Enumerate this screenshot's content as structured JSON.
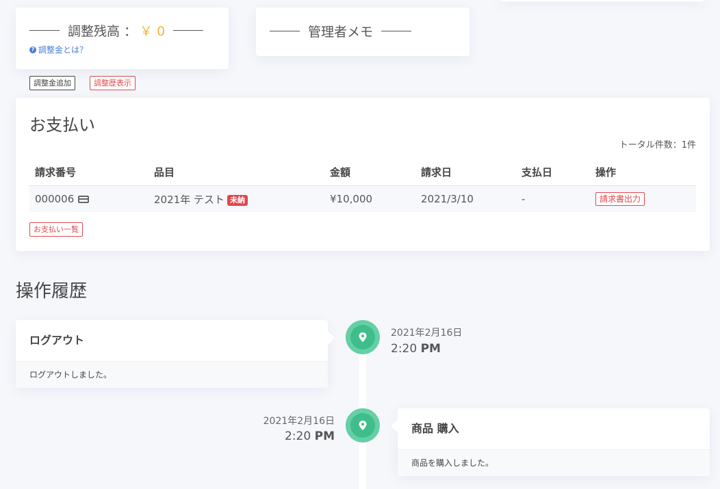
{
  "adjust": {
    "title": "調整残高 ：",
    "amount": "￥ 0",
    "help_link": "調整金とは？",
    "add_button": "調整金追加",
    "history_button": "調整歴表示"
  },
  "memo": {
    "title": "管理者メモ"
  },
  "payments": {
    "title": "お支払い",
    "total": "トータル件数：1件",
    "columns": [
      "請求番号",
      "品目",
      "金額",
      "請求日",
      "支払日",
      "操作"
    ],
    "rows": [
      {
        "invoice_no": "000006",
        "item": "2021年 テスト",
        "status_badge": "未納",
        "amount": "¥10,000",
        "invoice_date": "2021/3/10",
        "paid_date": "-",
        "action": "請求書出力"
      }
    ],
    "list_button": "お支払い一覧"
  },
  "history": {
    "title": "操作履歴",
    "events": [
      {
        "title": "ログアウト",
        "desc": "ログアウトしました。",
        "date": "2021年2月16日",
        "time": "2:20",
        "ampm": "PM"
      },
      {
        "title": "商品 購入",
        "desc": "商品を購入しました。",
        "date": "2021年2月16日",
        "time": "2:20",
        "ampm": "PM"
      }
    ]
  },
  "icons": {
    "card": "credit-card-icon",
    "pin": "map-pin-icon",
    "help": "question-circle-icon"
  },
  "colors": {
    "accent_amount": "#f5b63d",
    "danger": "#e0474c",
    "link": "#4a7dd6",
    "timeline": "#3fbd8b"
  }
}
